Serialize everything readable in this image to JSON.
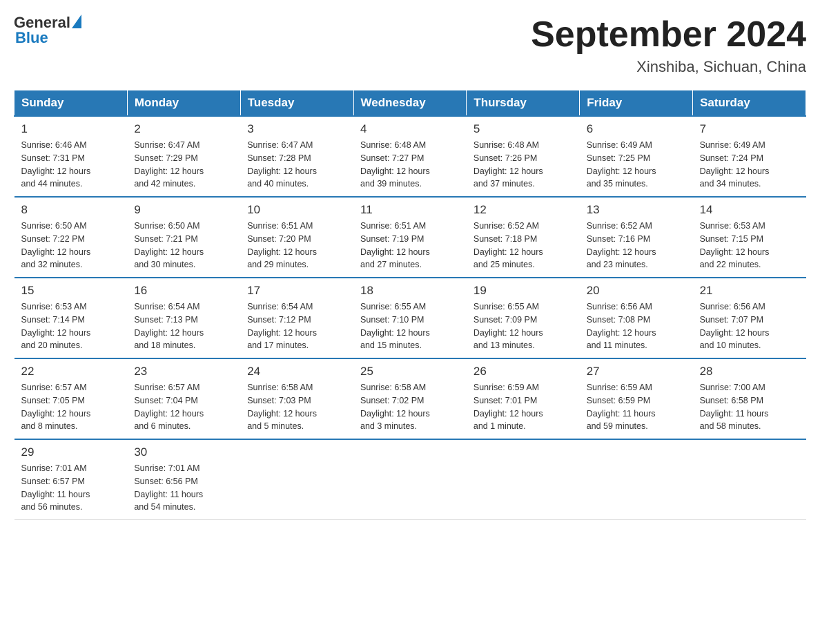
{
  "logo": {
    "text_general": "General",
    "text_blue": "Blue"
  },
  "calendar": {
    "title": "September 2024",
    "subtitle": "Xinshiba, Sichuan, China",
    "headers": [
      "Sunday",
      "Monday",
      "Tuesday",
      "Wednesday",
      "Thursday",
      "Friday",
      "Saturday"
    ],
    "weeks": [
      [
        {
          "day": "1",
          "info": "Sunrise: 6:46 AM\nSunset: 7:31 PM\nDaylight: 12 hours\nand 44 minutes."
        },
        {
          "day": "2",
          "info": "Sunrise: 6:47 AM\nSunset: 7:29 PM\nDaylight: 12 hours\nand 42 minutes."
        },
        {
          "day": "3",
          "info": "Sunrise: 6:47 AM\nSunset: 7:28 PM\nDaylight: 12 hours\nand 40 minutes."
        },
        {
          "day": "4",
          "info": "Sunrise: 6:48 AM\nSunset: 7:27 PM\nDaylight: 12 hours\nand 39 minutes."
        },
        {
          "day": "5",
          "info": "Sunrise: 6:48 AM\nSunset: 7:26 PM\nDaylight: 12 hours\nand 37 minutes."
        },
        {
          "day": "6",
          "info": "Sunrise: 6:49 AM\nSunset: 7:25 PM\nDaylight: 12 hours\nand 35 minutes."
        },
        {
          "day": "7",
          "info": "Sunrise: 6:49 AM\nSunset: 7:24 PM\nDaylight: 12 hours\nand 34 minutes."
        }
      ],
      [
        {
          "day": "8",
          "info": "Sunrise: 6:50 AM\nSunset: 7:22 PM\nDaylight: 12 hours\nand 32 minutes."
        },
        {
          "day": "9",
          "info": "Sunrise: 6:50 AM\nSunset: 7:21 PM\nDaylight: 12 hours\nand 30 minutes."
        },
        {
          "day": "10",
          "info": "Sunrise: 6:51 AM\nSunset: 7:20 PM\nDaylight: 12 hours\nand 29 minutes."
        },
        {
          "day": "11",
          "info": "Sunrise: 6:51 AM\nSunset: 7:19 PM\nDaylight: 12 hours\nand 27 minutes."
        },
        {
          "day": "12",
          "info": "Sunrise: 6:52 AM\nSunset: 7:18 PM\nDaylight: 12 hours\nand 25 minutes."
        },
        {
          "day": "13",
          "info": "Sunrise: 6:52 AM\nSunset: 7:16 PM\nDaylight: 12 hours\nand 23 minutes."
        },
        {
          "day": "14",
          "info": "Sunrise: 6:53 AM\nSunset: 7:15 PM\nDaylight: 12 hours\nand 22 minutes."
        }
      ],
      [
        {
          "day": "15",
          "info": "Sunrise: 6:53 AM\nSunset: 7:14 PM\nDaylight: 12 hours\nand 20 minutes."
        },
        {
          "day": "16",
          "info": "Sunrise: 6:54 AM\nSunset: 7:13 PM\nDaylight: 12 hours\nand 18 minutes."
        },
        {
          "day": "17",
          "info": "Sunrise: 6:54 AM\nSunset: 7:12 PM\nDaylight: 12 hours\nand 17 minutes."
        },
        {
          "day": "18",
          "info": "Sunrise: 6:55 AM\nSunset: 7:10 PM\nDaylight: 12 hours\nand 15 minutes."
        },
        {
          "day": "19",
          "info": "Sunrise: 6:55 AM\nSunset: 7:09 PM\nDaylight: 12 hours\nand 13 minutes."
        },
        {
          "day": "20",
          "info": "Sunrise: 6:56 AM\nSunset: 7:08 PM\nDaylight: 12 hours\nand 11 minutes."
        },
        {
          "day": "21",
          "info": "Sunrise: 6:56 AM\nSunset: 7:07 PM\nDaylight: 12 hours\nand 10 minutes."
        }
      ],
      [
        {
          "day": "22",
          "info": "Sunrise: 6:57 AM\nSunset: 7:05 PM\nDaylight: 12 hours\nand 8 minutes."
        },
        {
          "day": "23",
          "info": "Sunrise: 6:57 AM\nSunset: 7:04 PM\nDaylight: 12 hours\nand 6 minutes."
        },
        {
          "day": "24",
          "info": "Sunrise: 6:58 AM\nSunset: 7:03 PM\nDaylight: 12 hours\nand 5 minutes."
        },
        {
          "day": "25",
          "info": "Sunrise: 6:58 AM\nSunset: 7:02 PM\nDaylight: 12 hours\nand 3 minutes."
        },
        {
          "day": "26",
          "info": "Sunrise: 6:59 AM\nSunset: 7:01 PM\nDaylight: 12 hours\nand 1 minute."
        },
        {
          "day": "27",
          "info": "Sunrise: 6:59 AM\nSunset: 6:59 PM\nDaylight: 11 hours\nand 59 minutes."
        },
        {
          "day": "28",
          "info": "Sunrise: 7:00 AM\nSunset: 6:58 PM\nDaylight: 11 hours\nand 58 minutes."
        }
      ],
      [
        {
          "day": "29",
          "info": "Sunrise: 7:01 AM\nSunset: 6:57 PM\nDaylight: 11 hours\nand 56 minutes."
        },
        {
          "day": "30",
          "info": "Sunrise: 7:01 AM\nSunset: 6:56 PM\nDaylight: 11 hours\nand 54 minutes."
        },
        {
          "day": "",
          "info": ""
        },
        {
          "day": "",
          "info": ""
        },
        {
          "day": "",
          "info": ""
        },
        {
          "day": "",
          "info": ""
        },
        {
          "day": "",
          "info": ""
        }
      ]
    ]
  }
}
